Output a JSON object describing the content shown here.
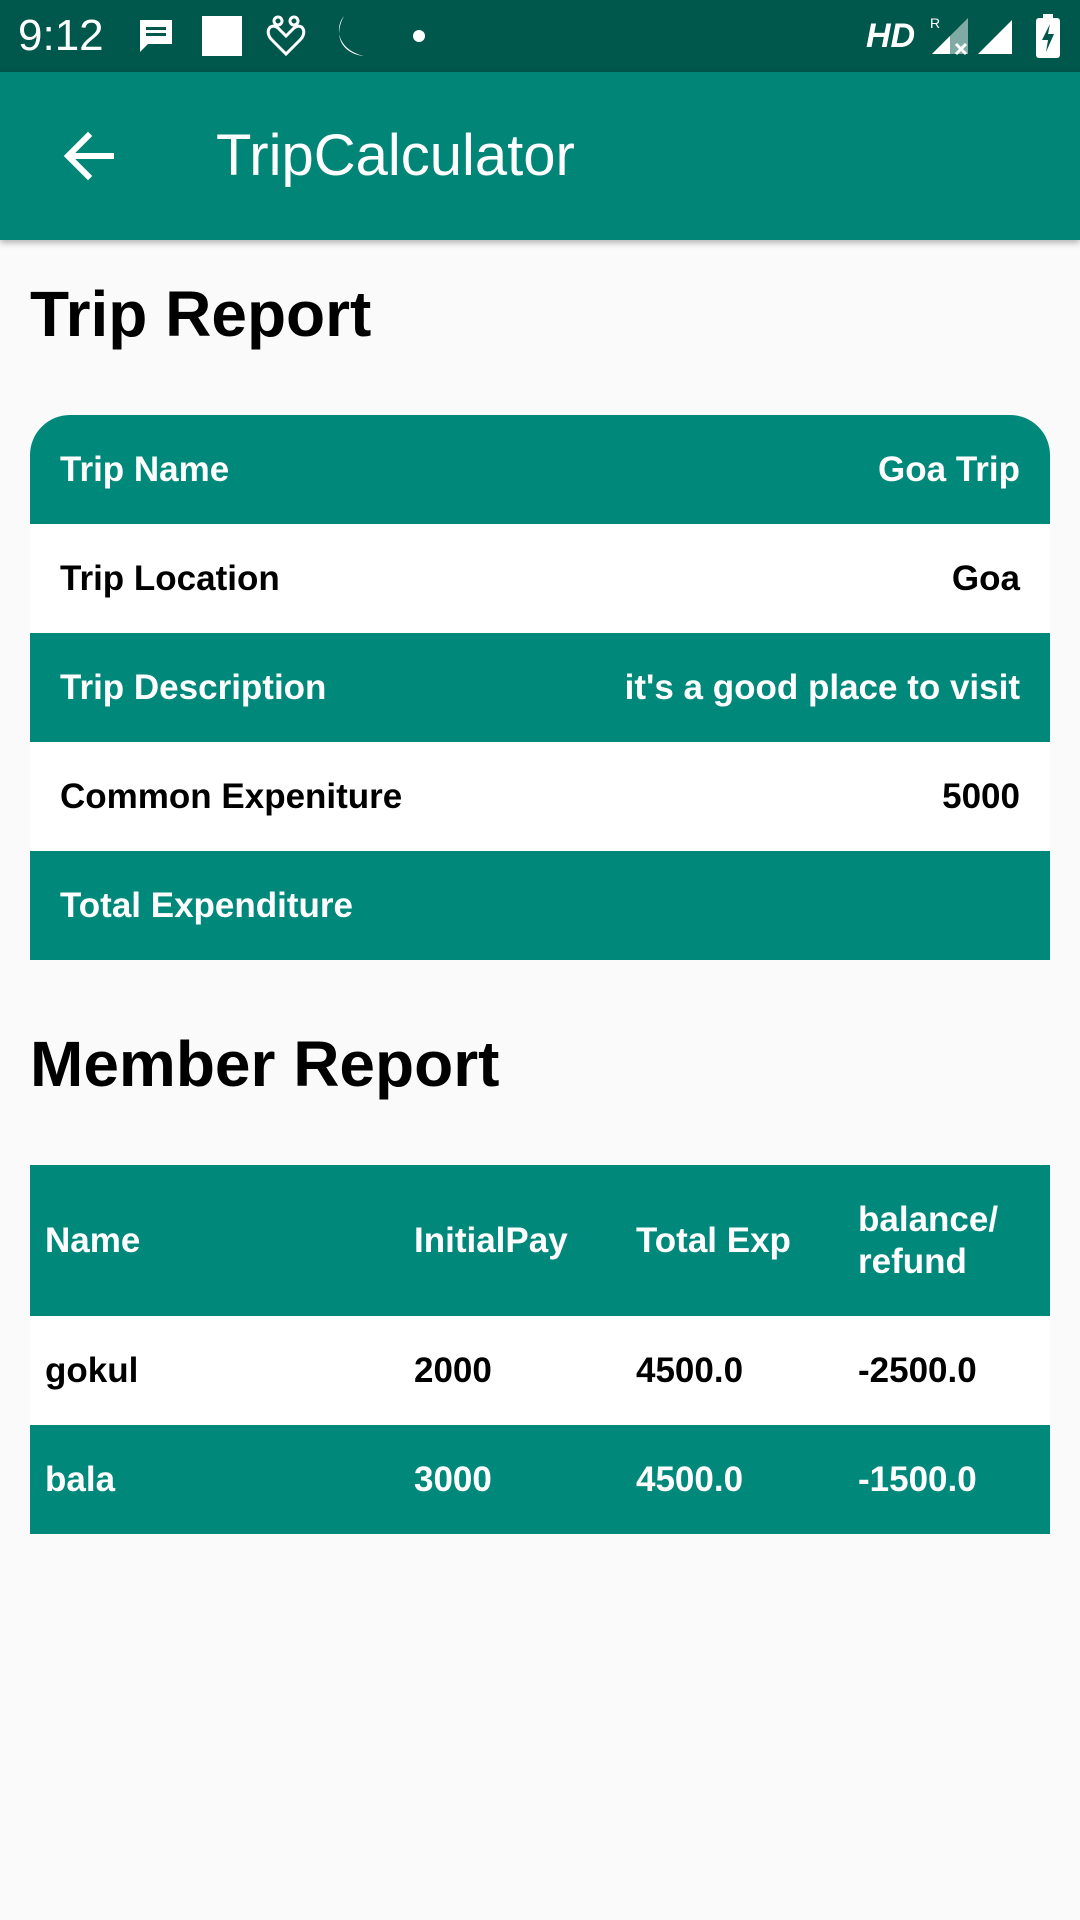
{
  "status_bar": {
    "time": "9:12",
    "network_label": "HD",
    "icons": [
      "message-icon",
      "square-icon",
      "hands-icon",
      "moon-icon",
      "dot-icon",
      "roaming-signal-icon",
      "signal-icon",
      "battery-charging-icon"
    ]
  },
  "app_bar": {
    "title": "TripCalculator",
    "back_icon": "arrow-left-icon"
  },
  "colors": {
    "status_bar": "#00574b",
    "app_bar": "#008577",
    "row_teal": "#00897b",
    "row_white": "#ffffff",
    "background": "#fafafa"
  },
  "trip_report": {
    "heading": "Trip Report",
    "rows": [
      {
        "label": "Trip Name",
        "value": "Goa Trip"
      },
      {
        "label": "Trip Location",
        "value": "Goa"
      },
      {
        "label": "Trip Description",
        "value": "it's a good place to visit"
      },
      {
        "label": "Common Expeniture",
        "value": "5000"
      },
      {
        "label": "Total Expenditure",
        "value": ""
      }
    ]
  },
  "member_report": {
    "heading": "Member Report",
    "columns": [
      "Name",
      "InitialPay",
      "Total Exp",
      "balance/\nrefund"
    ],
    "rows": [
      [
        "gokul",
        "2000",
        "4500.0",
        "-2500.0"
      ],
      [
        "bala",
        "3000",
        "4500.0",
        "-1500.0"
      ]
    ]
  }
}
